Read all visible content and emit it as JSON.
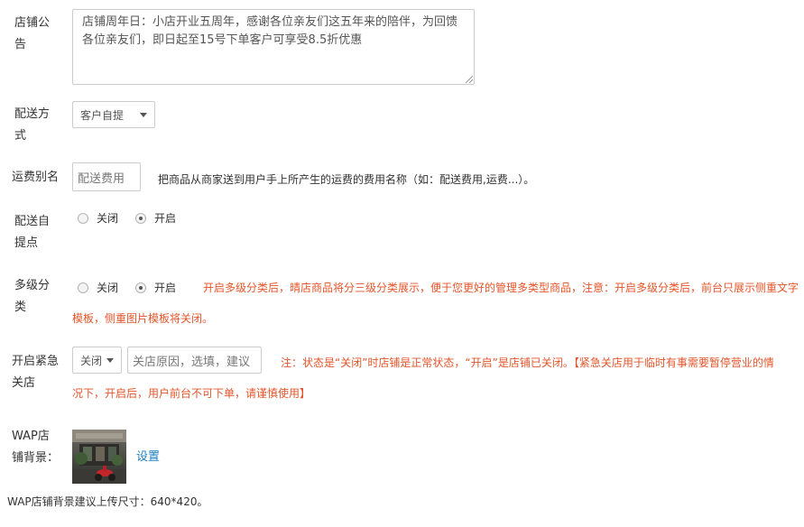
{
  "notice": {
    "label_line1": "店铺公",
    "label_line2": "告",
    "text": "店铺周年日：小店开业五周年，感谢各位亲友们这五年来的陪伴，为回馈各位亲友们，即日起至15号下单客户可享受8.5折优惠"
  },
  "delivery": {
    "label_line1": "配送方",
    "label_line2": "式",
    "selected": "客户自提"
  },
  "shipping_alias": {
    "label": "运费别名",
    "placeholder": "配送费用",
    "hint": "把商品从商家送到用户手上所产生的运费的费用名称（如：配送费用,运费...）。"
  },
  "pickup_point": {
    "label_line1": "配送自",
    "label_line2": "提点",
    "off_label": "关闭",
    "on_label": "开启",
    "selected": "开启"
  },
  "multi_category": {
    "label_line1": "多级分",
    "label_line2": "类",
    "off_label": "关闭",
    "on_label": "开启",
    "selected": "开启",
    "note_line1": "开启多级分类后，晴店商品将分三级分类展示，便于您更好的管理多类型商品，注意：开启多级分类后，前台只展示侧重文字",
    "note_line2": "模板，侧重图片模板将关闭。"
  },
  "emergency_close": {
    "label_line1": "开启紧急",
    "label_line2": "关店",
    "selected": "关闭",
    "reason_placeholder": "关店原因，选填，建议",
    "note_line1": "注：状态是“关闭”时店铺是正常状态，“开启”是店铺已关闭。【紧急关店用于临时有事需要暂停营业的情",
    "note_line2": "况下，开启后，用户前台不可下单，请谨慎使用】"
  },
  "wap_background": {
    "label_line1": "WAP店",
    "label_line2": "铺背景：",
    "set_link": "设置",
    "size_hint": "WAP店铺背景建议上传尺寸：640*420。"
  },
  "colors": {
    "accent_link": "#1a7fc1",
    "warning_text": "#e4552a"
  }
}
